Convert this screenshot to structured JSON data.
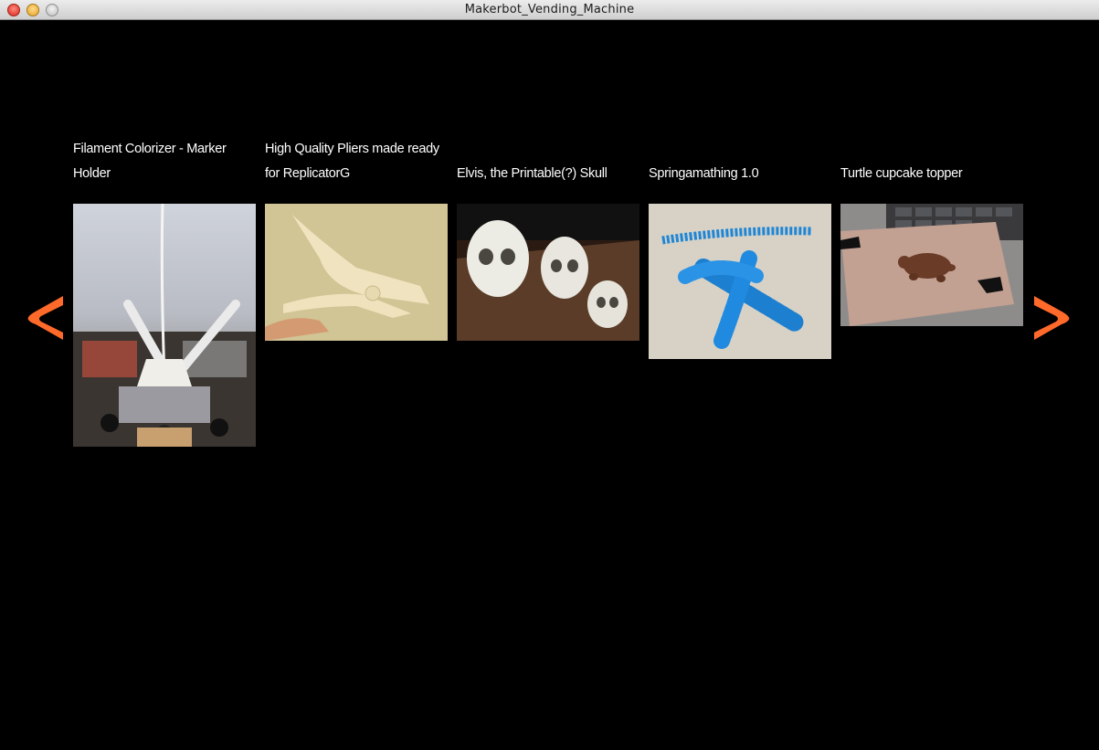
{
  "window": {
    "title": "Makerbot_Vending_Machine"
  },
  "colors": {
    "background": "#000000",
    "arrow": "#ff6a2b",
    "text": "#ffffff"
  },
  "nav": {
    "prev_icon": "chevron-left-icon",
    "next_icon": "chevron-right-icon"
  },
  "items": [
    {
      "title": "Filament Colorizer - Marker Holder",
      "thumbnail": "marker-holder-photo"
    },
    {
      "title": "High Quality Pliers made ready for ReplicatorG",
      "thumbnail": "pliers-photo"
    },
    {
      "title": "Elvis, the Printable(?) Skull",
      "thumbnail": "skulls-photo"
    },
    {
      "title": "Springamathing 1.0",
      "thumbnail": "blue-springs-photo"
    },
    {
      "title": "Turtle cupcake topper",
      "thumbnail": "turtle-topper-photo"
    }
  ]
}
